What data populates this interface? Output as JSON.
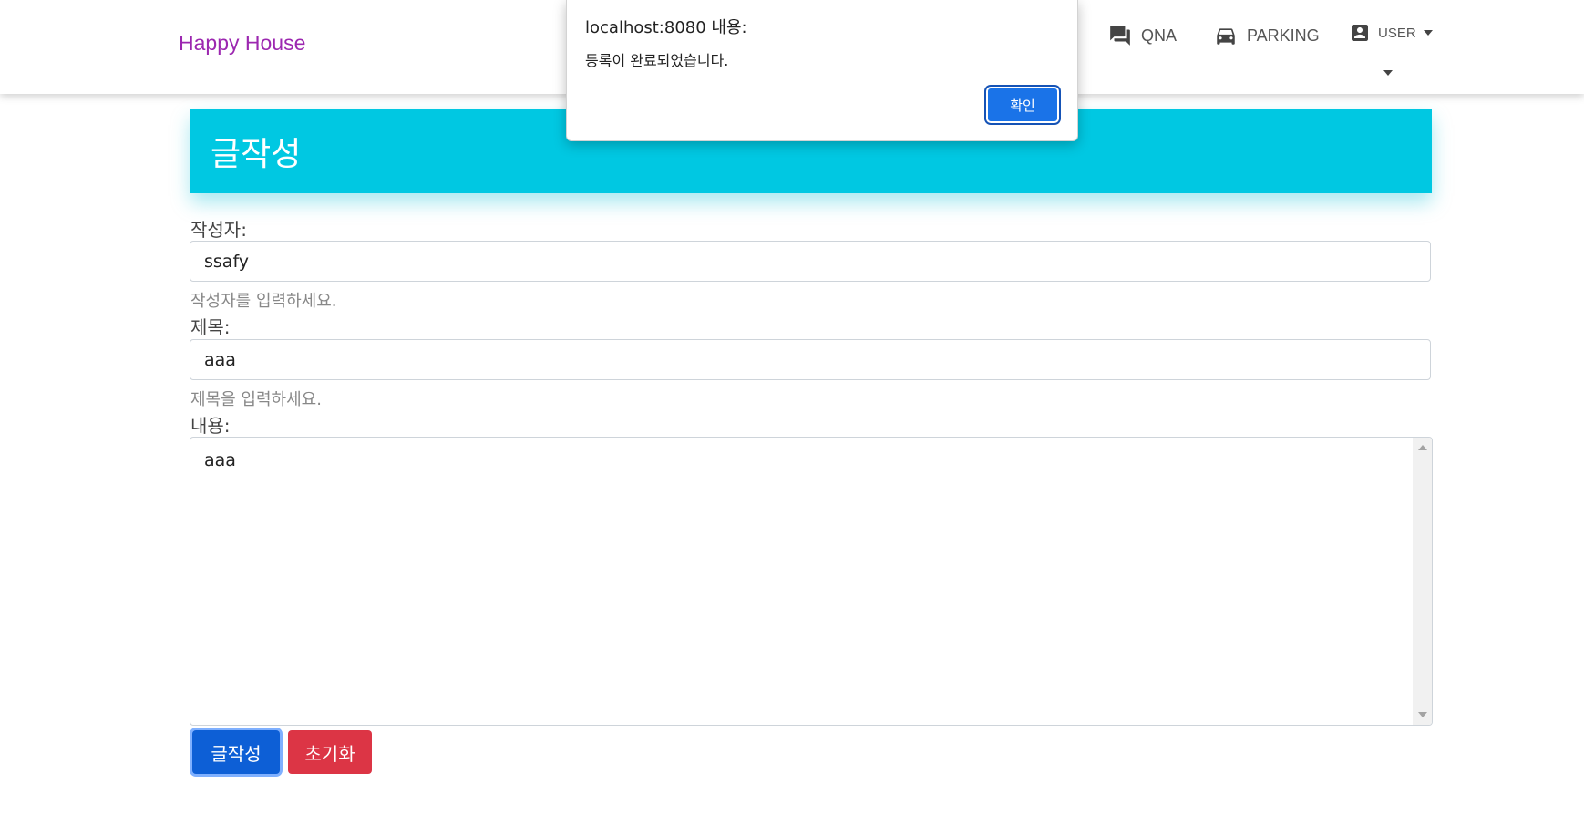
{
  "navbar": {
    "brand": "Happy House",
    "items": [
      {
        "label": "QNA",
        "icon": "forum-icon"
      },
      {
        "label": "PARKING",
        "icon": "car-icon"
      },
      {
        "label": "USER",
        "icon": "account-box-icon"
      }
    ]
  },
  "header": {
    "title": "글작성"
  },
  "form": {
    "writer_label": "작성자:",
    "writer_value": "ssafy",
    "writer_help": "작성자를 입력하세요.",
    "title_label": "제목:",
    "title_value": "aaa",
    "title_help": "제목을 입력하세요.",
    "content_label": "내용:",
    "content_value": "aaa",
    "submit_label": "글작성",
    "reset_label": "초기화"
  },
  "dialog": {
    "title": "localhost:8080 내용:",
    "message": "등록이 완료되었습니다.",
    "ok_label": "확인"
  },
  "colors": {
    "brand": "#9c27b0",
    "header_bg": "#00c8e2",
    "primary": "#0d5fd6",
    "danger": "#dc3545",
    "dialog_ok": "#1a73e8"
  }
}
